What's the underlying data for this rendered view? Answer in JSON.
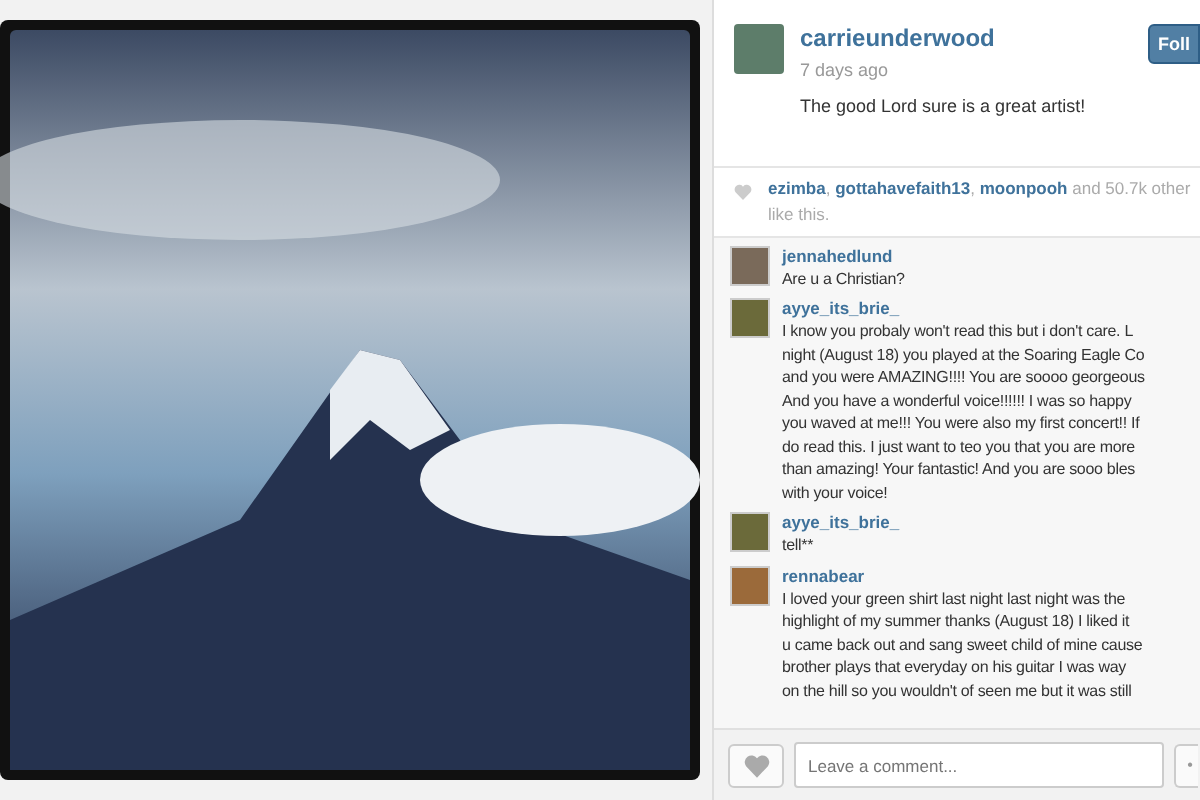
{
  "post": {
    "username": "carrieunderwood",
    "time": "7 days ago",
    "caption": "The good Lord sure is a great artist!",
    "follow_button": "Foll"
  },
  "likes": {
    "likers": [
      "ezimba",
      "gottahavefaith13",
      "moonpooh"
    ],
    "separator": ",",
    "joiner": "and",
    "count": "50.7k",
    "tail": "other",
    "second_line": "like this."
  },
  "comments": [
    {
      "username": "jennahedlund",
      "lines": [
        "Are u a Christian?"
      ]
    },
    {
      "username": "ayye_its_brie_",
      "lines": [
        "I know you probaly won't read this but i don't care. L",
        "night (August 18) you played at the Soaring Eagle Co",
        "and you were AMAZING!!!! You are soooo georgeous",
        "And you have a wonderful voice!!!!!! I was so happy",
        "you waved at me!!! You were also my first concert!! If",
        "do read this. I just want to teo you that you are more",
        "than amazing! Your fantastic! And you are sooo bles",
        "with your voice!"
      ]
    },
    {
      "username": "ayye_its_brie_",
      "lines": [
        "tell**"
      ]
    },
    {
      "username": "rennabear",
      "lines": [
        "I loved your green shirt last night last night was the",
        "highlight of my summer thanks (August 18) I liked it",
        "u came back out and sang sweet child of mine cause",
        "brother plays that everyday on his guitar I was way",
        "on the hill so you wouldn't of seen me but it was still"
      ]
    }
  ],
  "comment_box": {
    "placeholder": "Leave a comment...",
    "more_button": "•"
  }
}
